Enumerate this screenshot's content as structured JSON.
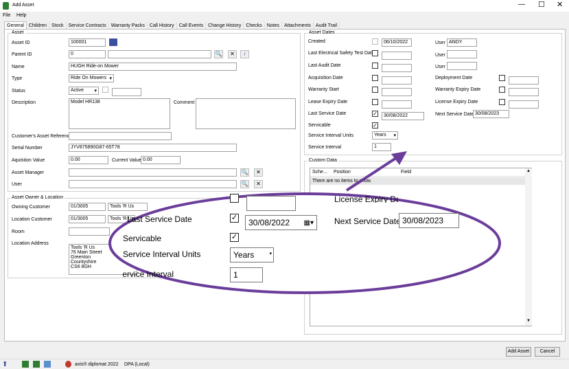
{
  "window": {
    "title": "Add Asset",
    "menu": [
      "File",
      "Help"
    ]
  },
  "tabs": [
    "General",
    "Children",
    "Stock",
    "Service Contracts",
    "Warranty Packs",
    "Call History",
    "Call Events",
    "Change History",
    "Checks",
    "Notes",
    "Attachments",
    "Audit Trail"
  ],
  "asset": {
    "group_title": "Asset",
    "asset_id_label": "Asset ID",
    "asset_id": "100001",
    "parent_id_label": "Parent ID",
    "parent_id": "0",
    "name_label": "Name",
    "name": "HUGH Ride-on Mower",
    "type_label": "Type",
    "type": "Ride On Mowers",
    "status_label": "Status",
    "status": "Active",
    "description_label": "Description",
    "description": "Model HR138",
    "comment_label": "Comment",
    "customer_ref_label": "Customer's Asset Reference",
    "serial_label": "Serial Number",
    "serial": "JYV875890G87-65T78",
    "acq_value_label": "Aquistion Value",
    "acq_value": "0.00",
    "current_value_label": "Current Value",
    "current_value": "0.00",
    "asset_manager_label": "Asset Manager",
    "user_label": "User"
  },
  "owner": {
    "group_title": "Asset Owner & Location",
    "owning_customer_label": "Owning Customer",
    "owning_customer_code": "01/3005",
    "owning_customer_name": "Tools 'R Us",
    "location_customer_label": "Location Customer",
    "location_customer_code": "01/3005",
    "location_customer_name": "Tools 'R Us",
    "room_label": "Room",
    "location_address_label": "Location Address",
    "address_lines": [
      "Tools 'R Us",
      "76 Main Street",
      "Greenton",
      "Countyshire",
      "CS6 8GH"
    ]
  },
  "dates": {
    "group_title": "Asset Dates",
    "created_label": "Created",
    "created": "06/10/2022",
    "user1_label": "User",
    "user1": "ANDY",
    "elec_label": "Last Electrical Safety Test Date",
    "user2_label": "User",
    "audit_label": "Last Audit Date",
    "user3_label": "User",
    "acq_date_label": "Acquisition Date",
    "deploy_label": "Deployment Date",
    "warranty_start_label": "Warranty Start",
    "warranty_expiry_label": "Warranty Expiry Date",
    "lease_label": "Lease Expiry Date",
    "license_label": "License Expiry Date",
    "last_service_label": "Last Service Date",
    "last_service": "30/08/2022",
    "next_service_label": "Next Service Date",
    "next_service": "30/08/2023",
    "servicable_label": "Servicable",
    "interval_units_label": "Service Interval Units",
    "interval_units": "Years",
    "interval_label": "Service Interval",
    "interval": "1"
  },
  "custom": {
    "group_title": "Custom Data",
    "columns": [
      "Sche...",
      "Position",
      "Field"
    ],
    "empty_text": "There are no items to show."
  },
  "zoom": {
    "license_label": "License Expiry Date",
    "last_service_label": "Last Service Date",
    "last_service": "30/08/2022",
    "next_service_label": "Next Service Date",
    "next_service": "30/08/2023",
    "servicable_label": "Servicable",
    "interval_units_label": "Service Interval Units",
    "interval_units": "Years",
    "interval_label": "Service Interval",
    "interval": "1"
  },
  "buttons": {
    "add": "Add Asset",
    "cancel": "Cancel"
  },
  "status_bar": {
    "product": "axis® diplomat 2022",
    "db": "DPA (Local)"
  },
  "colors": {
    "callout": "#6a3d9a",
    "accent": "#2f7d32"
  }
}
